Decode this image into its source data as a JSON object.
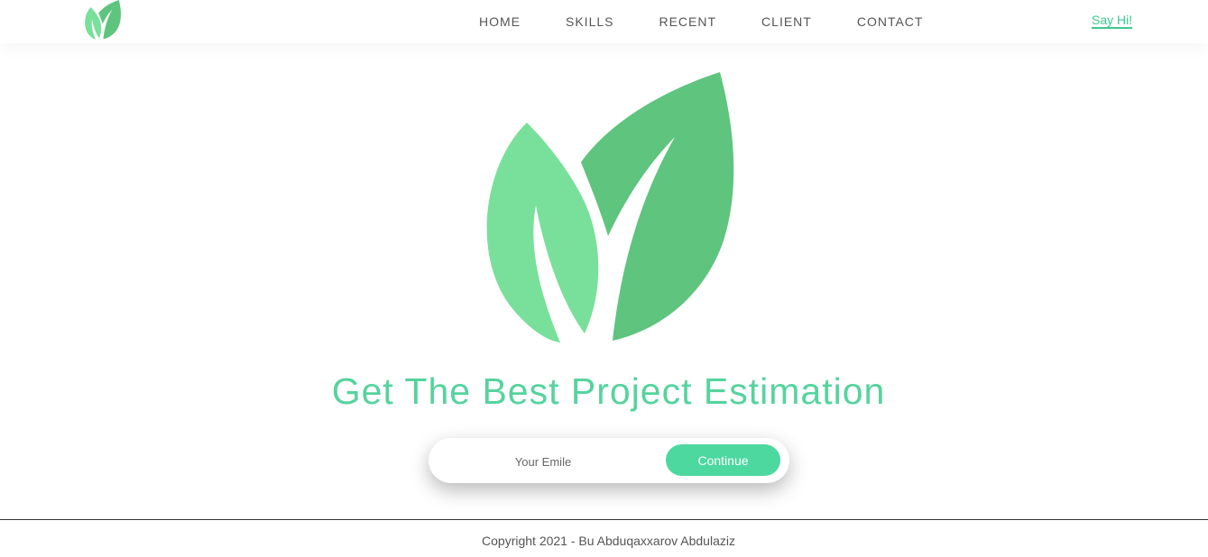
{
  "header": {
    "logo_icon": "leaf-logo-icon",
    "nav": [
      {
        "label": "HOME"
      },
      {
        "label": "SKILLS"
      },
      {
        "label": "RECENT"
      },
      {
        "label": "CLIENT"
      },
      {
        "label": "CONTACT"
      }
    ],
    "say_hi": "Say Hi!"
  },
  "hero": {
    "logo_icon": "leaf-logo-icon",
    "title": "Get The Best Project Estimation",
    "email_placeholder": "Your Emile",
    "continue_label": "Continue"
  },
  "footer": {
    "copyright": "Copyright 2021 - Bu Abduqaxxarov Abdulaziz"
  },
  "colors": {
    "brand_green": "#56d39e",
    "button_green": "#4dd8a0",
    "leaf_light": "#78e09a",
    "leaf_dark": "#5ec47e"
  }
}
